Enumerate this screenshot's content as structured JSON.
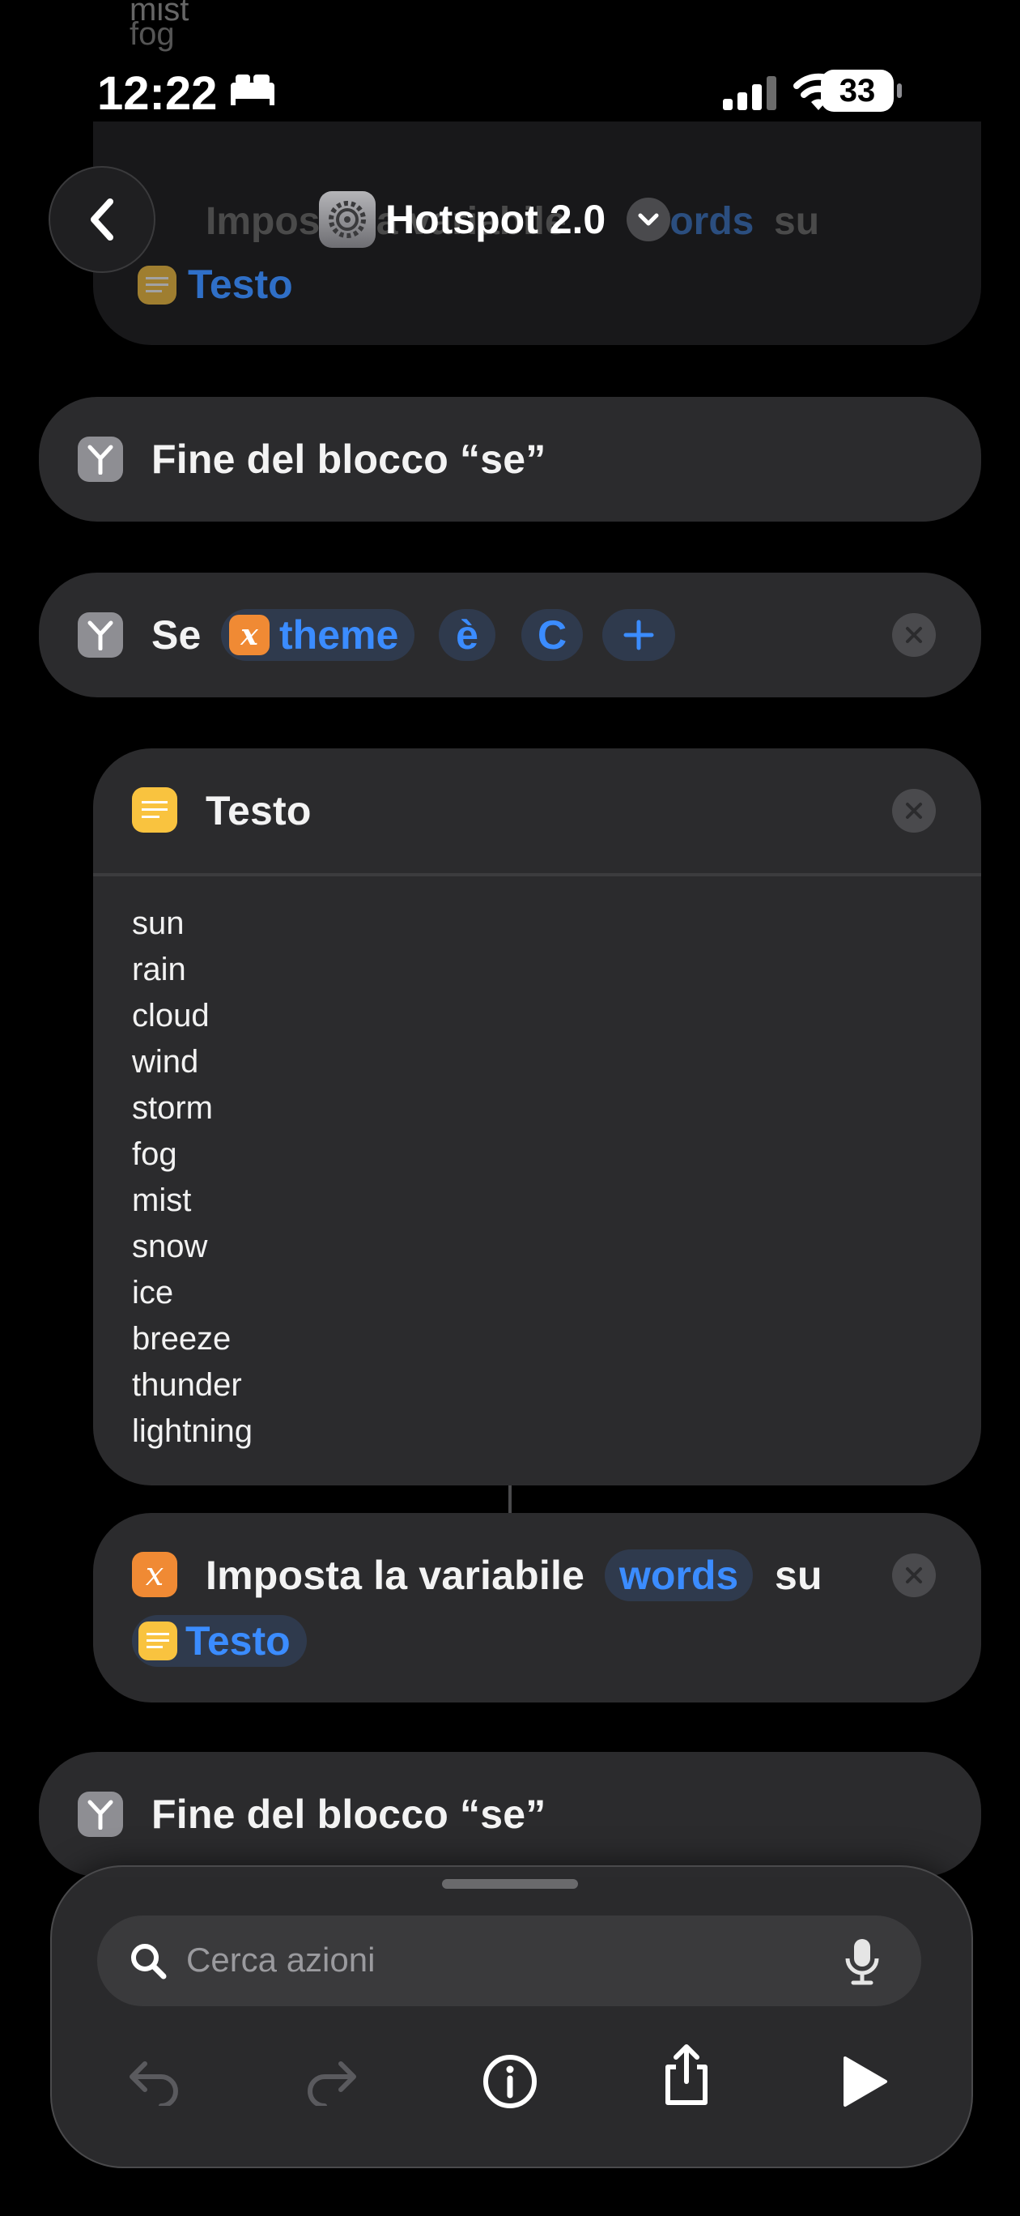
{
  "status_bar": {
    "time": "12:22",
    "battery": "33"
  },
  "nav": {
    "title": "Hotspot 2.0"
  },
  "top_faded": {
    "text_partial": "Imposta la variabile",
    "pill": "words",
    "su": "su",
    "testo": "Testo",
    "small_lines": [
      "mist",
      "fog"
    ]
  },
  "blocks": {
    "end_if_1": {
      "label": "Fine del blocco “se”"
    },
    "if_block": {
      "se": "Se",
      "var": "theme",
      "op": "è",
      "value": "C"
    },
    "text_action": {
      "title": "Testo",
      "lines": [
        "sun",
        "rain",
        "cloud",
        "wind",
        "storm",
        "fog",
        "mist",
        "snow",
        "ice",
        "breeze",
        "thunder",
        "lightning"
      ]
    },
    "set_var": {
      "label": "Imposta la variabile",
      "var": "words",
      "su": "su",
      "input": "Testo"
    },
    "end_if_2": {
      "label": "Fine del blocco “se”"
    }
  },
  "toolbar": {
    "search_placeholder": "Cerca azioni"
  },
  "icons": {
    "accent_blue": "#3b8cff",
    "orange": "#f08a34",
    "yellow": "#f9c33f"
  }
}
